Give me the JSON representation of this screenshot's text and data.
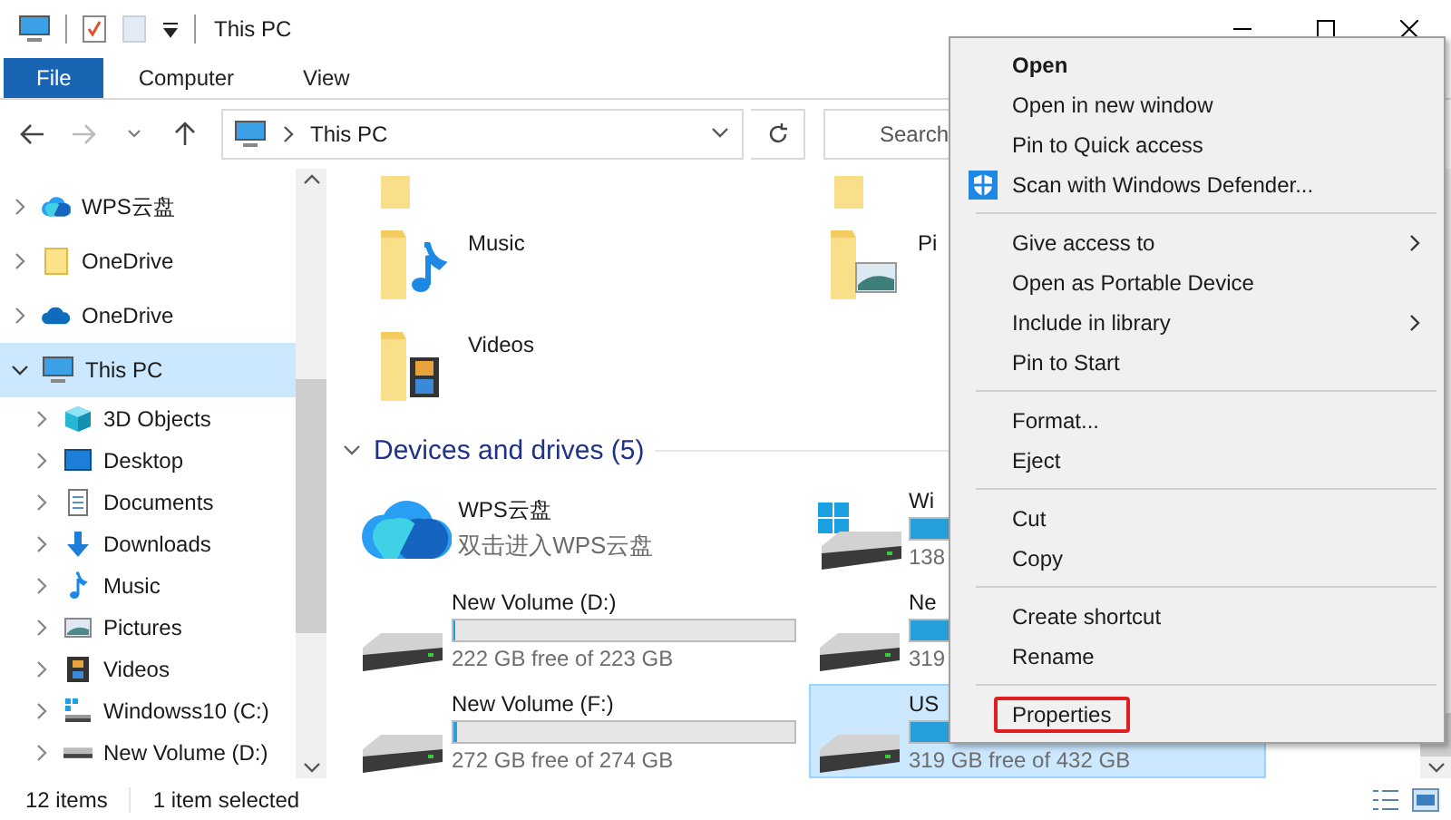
{
  "window": {
    "title": "This PC"
  },
  "ribbon_tabs": [
    {
      "label": "File",
      "selected": true
    },
    {
      "label": "Computer",
      "selected": false
    },
    {
      "label": "View",
      "selected": false
    }
  ],
  "address_bar": {
    "path": "This PC"
  },
  "search": {
    "placeholder": "Search"
  },
  "nav_pane": {
    "items": [
      {
        "label": "WPS云盘",
        "kind": "wps-cloud",
        "expanded": false,
        "selected": false
      },
      {
        "label": "OneDrive",
        "kind": "folder",
        "expanded": false,
        "selected": false
      },
      {
        "label": "OneDrive",
        "kind": "onedrive",
        "expanded": false,
        "selected": false
      },
      {
        "label": "This PC",
        "kind": "pc",
        "expanded": true,
        "selected": true,
        "children": [
          {
            "label": "3D Objects",
            "kind": "cube",
            "expanded": false,
            "selected": false
          },
          {
            "label": "Desktop",
            "kind": "desktop",
            "expanded": false,
            "selected": false
          },
          {
            "label": "Documents",
            "kind": "documents",
            "expanded": false,
            "selected": false
          },
          {
            "label": "Downloads",
            "kind": "downloads",
            "expanded": false,
            "selected": false
          },
          {
            "label": "Music",
            "kind": "music",
            "expanded": false,
            "selected": false
          },
          {
            "label": "Pictures",
            "kind": "pictures",
            "expanded": false,
            "selected": false
          },
          {
            "label": "Videos",
            "kind": "videos",
            "expanded": false,
            "selected": false
          },
          {
            "label": "Windowss10 (C:)",
            "kind": "system-drive",
            "expanded": false,
            "selected": false
          },
          {
            "label": "New Volume (D:)",
            "kind": "drive",
            "expanded": false,
            "selected": false
          }
        ]
      }
    ]
  },
  "folders": [
    {
      "label": "Music",
      "kind": "music"
    },
    {
      "label": "Pi",
      "kind": "pictures"
    },
    {
      "label": "Videos",
      "kind": "videos"
    }
  ],
  "devices": {
    "title": "Devices and drives (5)",
    "expanded": true,
    "items": [
      {
        "kind": "cloud",
        "name": "WPS云盘",
        "subtitle": "双击进入WPS云盘",
        "selected": false
      },
      {
        "kind": "system-drive",
        "name": "Wi",
        "level": 0.75,
        "free": "138",
        "selected": false
      },
      {
        "kind": "drive",
        "name": "New Volume (D:)",
        "level": 0.005,
        "free": "222 GB free of 223 GB",
        "selected": false
      },
      {
        "kind": "drive",
        "name": "Ne",
        "level": 0.26,
        "free": "319",
        "selected": false
      },
      {
        "kind": "drive",
        "name": "New Volume (F:)",
        "level": 0.008,
        "free": "272 GB free of 274 GB",
        "selected": false
      },
      {
        "kind": "drive",
        "name": "US",
        "level": 0.26,
        "free": "319 GB free of 432 GB",
        "selected": true
      }
    ]
  },
  "status_bar": {
    "item_count": "12 items",
    "selection": "1 item selected"
  },
  "context_menu": {
    "items": [
      {
        "kind": "item",
        "label": "Open",
        "default": true,
        "submenu": false,
        "highlighted": false
      },
      {
        "kind": "item",
        "label": "Open in new window",
        "default": false,
        "submenu": false,
        "highlighted": false
      },
      {
        "kind": "item",
        "label": "Pin to Quick access",
        "default": false,
        "submenu": false,
        "highlighted": false
      },
      {
        "kind": "icon-item",
        "label": "Scan with Windows Defender...",
        "default": false,
        "submenu": false,
        "highlighted": false
      },
      {
        "kind": "separator"
      },
      {
        "kind": "item",
        "label": "Give access to",
        "default": false,
        "submenu": true,
        "highlighted": false
      },
      {
        "kind": "item",
        "label": "Open as Portable Device",
        "default": false,
        "submenu": false,
        "highlighted": false
      },
      {
        "kind": "item",
        "label": "Include in library",
        "default": false,
        "submenu": true,
        "highlighted": false
      },
      {
        "kind": "item",
        "label": "Pin to Start",
        "default": false,
        "submenu": false,
        "highlighted": false
      },
      {
        "kind": "separator"
      },
      {
        "kind": "item",
        "label": "Format...",
        "default": false,
        "submenu": false,
        "highlighted": false
      },
      {
        "kind": "item",
        "label": "Eject",
        "default": false,
        "submenu": false,
        "highlighted": false
      },
      {
        "kind": "separator"
      },
      {
        "kind": "item",
        "label": "Cut",
        "default": false,
        "submenu": false,
        "highlighted": false
      },
      {
        "kind": "item",
        "label": "Copy",
        "default": false,
        "submenu": false,
        "highlighted": false
      },
      {
        "kind": "separator"
      },
      {
        "kind": "item",
        "label": "Create shortcut",
        "default": false,
        "submenu": false,
        "highlighted": false
      },
      {
        "kind": "item",
        "label": "Rename",
        "default": false,
        "submenu": false,
        "highlighted": false
      },
      {
        "kind": "separator"
      },
      {
        "kind": "item",
        "label": "Properties",
        "default": false,
        "submenu": false,
        "highlighted": true
      }
    ]
  }
}
